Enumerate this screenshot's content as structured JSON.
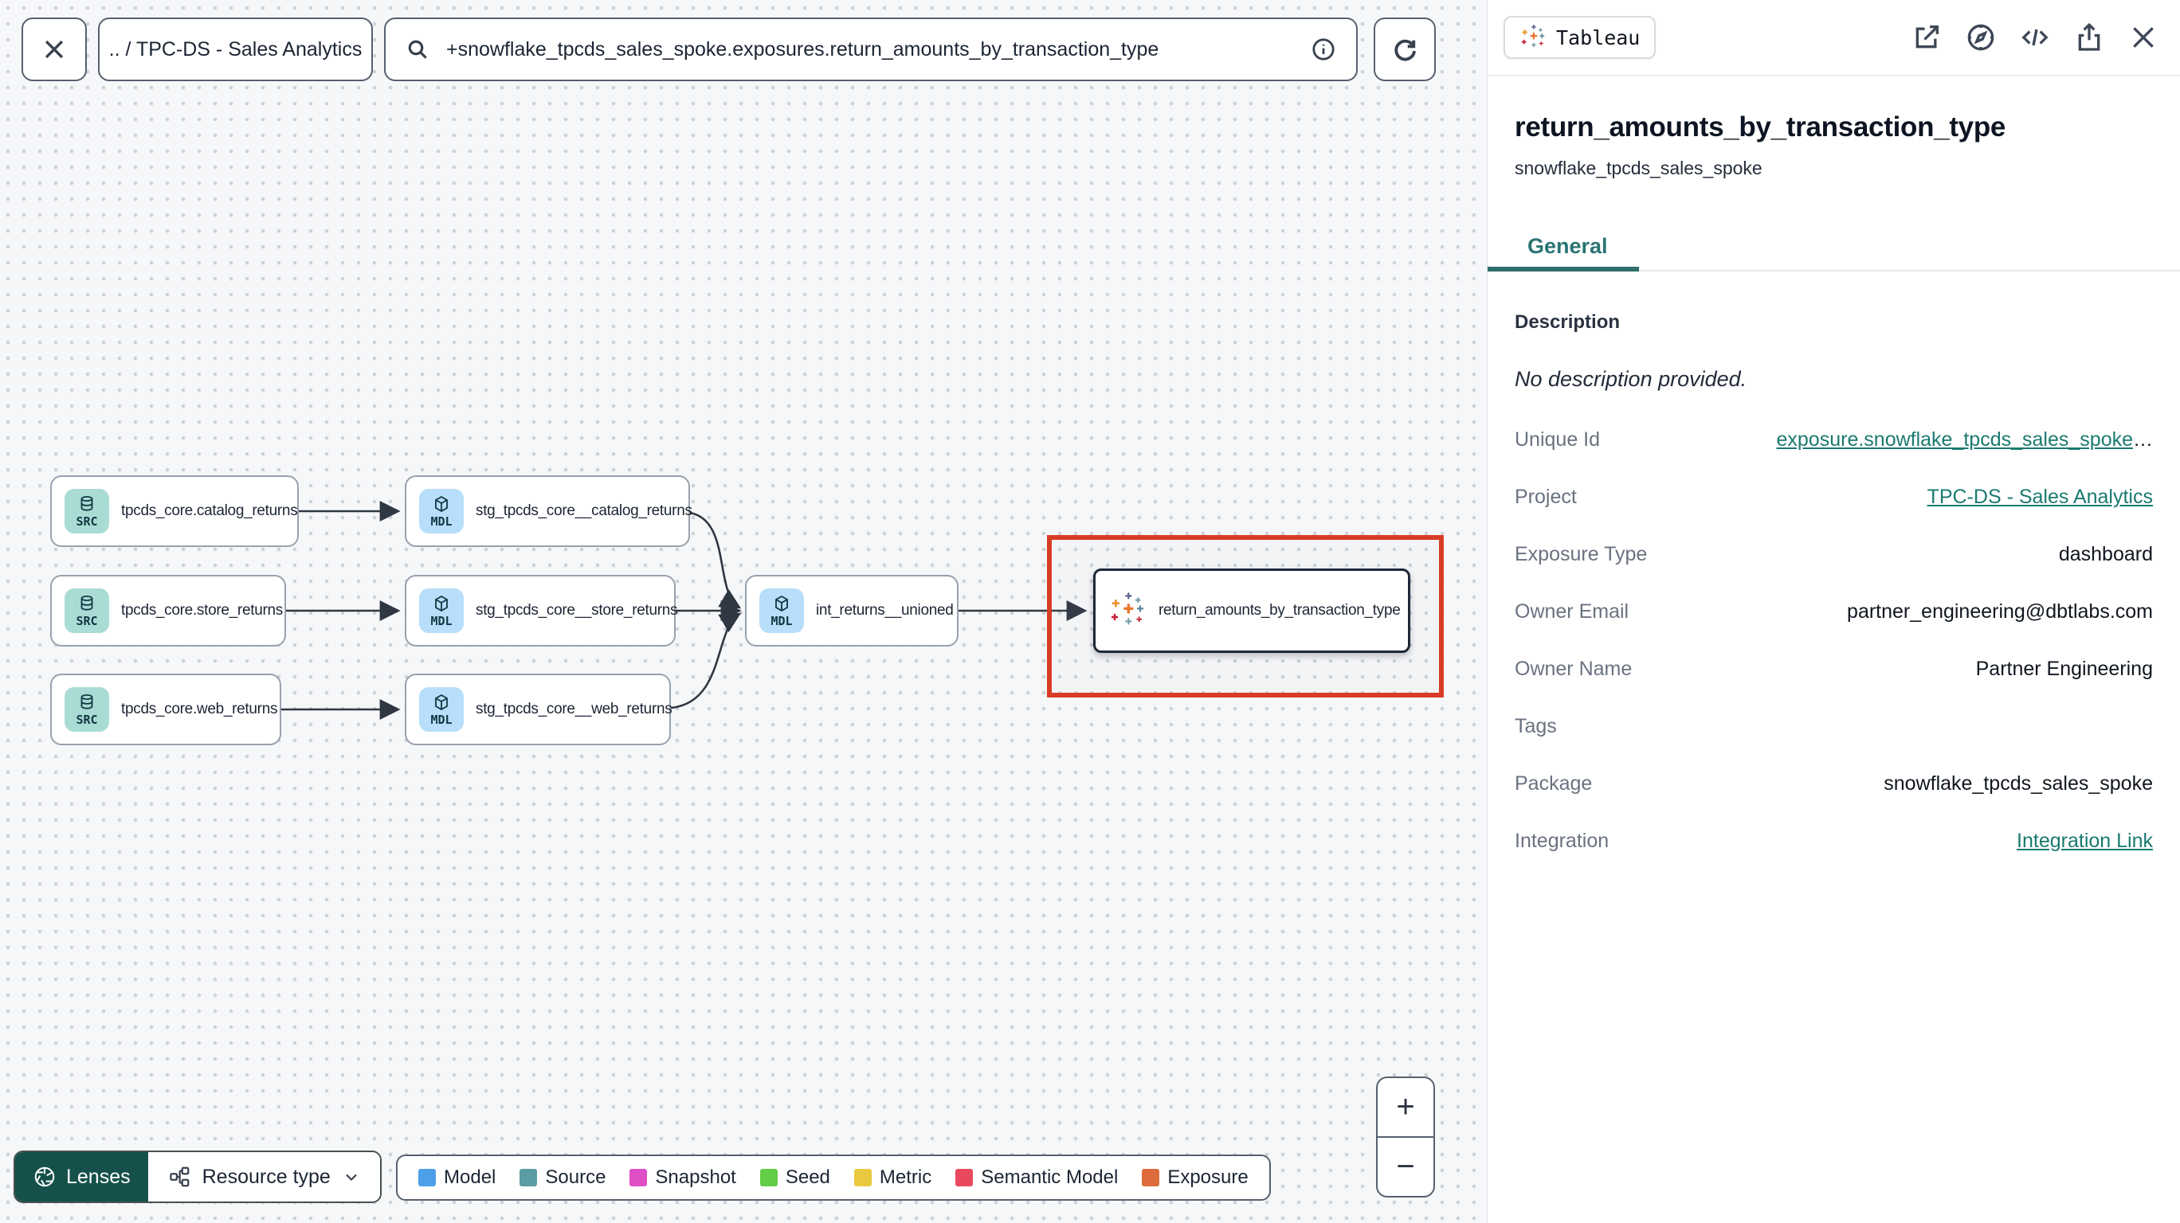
{
  "toolbar": {
    "breadcrumb": ".. / TPC-DS - Sales Analytics",
    "search": {
      "value": "+snowflake_tpcds_sales_spoke.exposures.return_amounts_by_transaction_type",
      "info_icon": "info-circle-icon"
    },
    "close_icon": "close-x-icon",
    "search_icon": "magnifier-icon",
    "refresh_icon": "refresh-icon"
  },
  "graph": {
    "nodes": [
      {
        "label": "tpcds_core.catalog_returns",
        "badge": "SRC",
        "type": "source",
        "icon": "database-icon"
      },
      {
        "label": "tpcds_core.store_returns",
        "badge": "SRC",
        "type": "source",
        "icon": "database-icon"
      },
      {
        "label": "tpcds_core.web_returns",
        "badge": "SRC",
        "type": "source",
        "icon": "database-icon"
      },
      {
        "label": "stg_tpcds_core__catalog_returns",
        "badge": "MDL",
        "type": "model",
        "icon": "cube-icon"
      },
      {
        "label": "stg_tpcds_core__store_returns",
        "badge": "MDL",
        "type": "model",
        "icon": "cube-icon"
      },
      {
        "label": "stg_tpcds_core__web_returns",
        "badge": "MDL",
        "type": "model",
        "icon": "cube-icon"
      },
      {
        "label": "int_returns__unioned",
        "badge": "MDL",
        "type": "model",
        "icon": "cube-icon"
      },
      {
        "label": "return_amounts_by_transaction_type",
        "type": "exposure",
        "icon": "tableau-logo-icon",
        "selected": true
      }
    ],
    "selection_highlight_color": "#d93c26"
  },
  "controls": {
    "lenses_label": "Lenses",
    "resource_type_label": "Resource type",
    "zoom_in": "+",
    "zoom_out": "−"
  },
  "legend": {
    "items": [
      {
        "label": "Model",
        "color": "#4e9fe9"
      },
      {
        "label": "Source",
        "color": "#5b9da3"
      },
      {
        "label": "Snapshot",
        "color": "#df4fc6"
      },
      {
        "label": "Seed",
        "color": "#62cd46"
      },
      {
        "label": "Metric",
        "color": "#e9c93f"
      },
      {
        "label": "Semantic Model",
        "color": "#e8495f"
      },
      {
        "label": "Exposure",
        "color": "#dd6b3c"
      }
    ]
  },
  "panel": {
    "badge": "Tableau",
    "title": "return_amounts_by_transaction_type",
    "subtitle": "snowflake_tpcds_sales_spoke",
    "active_tab": "General",
    "accent_color": "#2e6e6c",
    "description_heading": "Description",
    "description_text": "No description provided.",
    "fields": [
      {
        "label": "Unique Id",
        "value": "exposure.snowflake_tpcds_sales_spoke",
        "suffix": "…",
        "link": true
      },
      {
        "label": "Project",
        "value": "TPC-DS - Sales Analytics",
        "link": true
      },
      {
        "label": "Exposure Type",
        "value": "dashboard",
        "link": false
      },
      {
        "label": "Owner Email",
        "value": "partner_engineering@dbtlabs.com",
        "link": false
      },
      {
        "label": "Owner Name",
        "value": "Partner Engineering",
        "link": false
      },
      {
        "label": "Tags",
        "value": "",
        "link": false
      },
      {
        "label": "Package",
        "value": "snowflake_tpcds_sales_spoke",
        "link": false
      },
      {
        "label": "Integration",
        "value": "Integration Link",
        "link": true
      }
    ]
  }
}
